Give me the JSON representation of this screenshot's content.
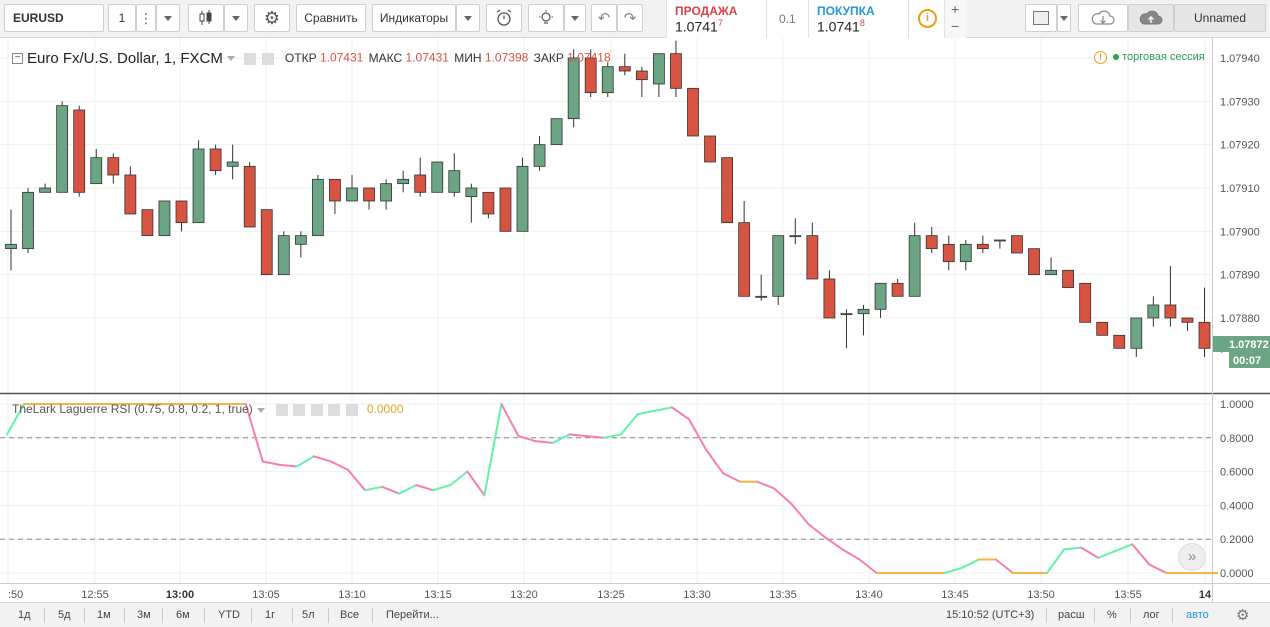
{
  "toolbar": {
    "symbol": "EURUSD",
    "interval": "1",
    "compare": "Сравнить",
    "indicators": "Индикаторы",
    "sell_label": "ПРОДАЖА",
    "sell_price_main": "1.0741",
    "sell_price_sup": "7",
    "spread": "0.1",
    "buy_label": "ПОКУПКА",
    "buy_price_main": "1.0741",
    "buy_price_sup": "8",
    "plus": "+",
    "minus": "−",
    "layout_name": "Unnamed",
    "info": "i"
  },
  "legend": {
    "title": "Euro Fx/U.S. Dollar, 1, FXCM",
    "open_label": "ОТКР",
    "open_value": "1.07431",
    "high_label": "МАКС",
    "high_value": "1.07431",
    "low_label": "МИН",
    "low_value": "1.07398",
    "close_label": "ЗАКР",
    "close_value": "1.07418",
    "session_text": "торговая сессия",
    "indicator_title": "TheLark Laguerre RSI (0.75, 0.8, 0.2, 1, true)",
    "indicator_value": "0.0000"
  },
  "price_axis": {
    "current_price": "1.07872",
    "countdown": "00:07"
  },
  "bottombar": {
    "ranges": [
      "1д",
      "5д",
      "1м",
      "3м",
      "6м",
      "YTD",
      "1г",
      "5л",
      "Все"
    ],
    "goto": "Перейти...",
    "clock": "15:10:52 (UTC+3)",
    "pct_scale": "расш",
    "pct": "%",
    "log": "лог",
    "auto": "авто"
  },
  "colors": {
    "up": "#6ba583",
    "down": "#d75442",
    "red_text": "#e0404a",
    "blue_text": "#1f9ad6",
    "session_green": "#2c9e55",
    "info_orange": "#f39c12",
    "rsi_up": "#62f2a8",
    "rsi_down": "#f77fa9",
    "rsi_flat": "#f5b53f"
  },
  "chart_data": [
    {
      "type": "candlestick",
      "title": "Euro Fx/U.S. Dollar, 1, FXCM",
      "y_ticks": [
        1.0794,
        1.0793,
        1.0792,
        1.0791,
        1.079,
        1.0789,
        1.0788
      ],
      "y_tick_labels": [
        "1.07940",
        "1.07930",
        "1.07920",
        "1.07910",
        "1.07900",
        "1.07890",
        "1.07880"
      ],
      "ylim": [
        1.0786,
        1.0795
      ],
      "x_tick_labels": [
        ":50",
        "12:55",
        "13:00",
        "13:05",
        "13:10",
        "13:15",
        "13:20",
        "13:25",
        "13:30",
        "13:35",
        "13:40",
        "13:45",
        "13:50",
        "13:55",
        "14"
      ],
      "candles": [
        [
          1.07896,
          1.07896,
          1.07897,
          1.07905,
          1.07891
        ],
        [
          1.07898,
          1.07896,
          1.07909,
          1.0791,
          1.07895
        ],
        [
          1.07909,
          1.07909,
          1.0791,
          1.07911,
          1.07909
        ],
        [
          1.07909,
          1.07909,
          1.07929,
          1.0793,
          1.07909
        ],
        [
          1.07928,
          1.07928,
          1.07909,
          1.07929,
          1.07908
        ],
        [
          1.07911,
          1.07911,
          1.07917,
          1.07919,
          1.07911
        ],
        [
          1.07917,
          1.07917,
          1.07913,
          1.07918,
          1.07911
        ],
        [
          1.07913,
          1.07913,
          1.07904,
          1.07915,
          1.07904
        ],
        [
          1.07905,
          1.07905,
          1.07899,
          1.07905,
          1.07899
        ],
        [
          1.07899,
          1.07899,
          1.07907,
          1.07907,
          1.07899
        ],
        [
          1.07907,
          1.07907,
          1.07902,
          1.07907,
          1.079
        ],
        [
          1.07902,
          1.07902,
          1.07919,
          1.07921,
          1.07902
        ],
        [
          1.07919,
          1.07919,
          1.07914,
          1.0792,
          1.07913
        ],
        [
          1.07915,
          1.07915,
          1.07916,
          1.0792,
          1.07912
        ],
        [
          1.07915,
          1.07915,
          1.07901,
          1.07916,
          1.07901
        ],
        [
          1.07905,
          1.07905,
          1.0789,
          1.07905,
          1.0789
        ],
        [
          1.0789,
          1.0789,
          1.07899,
          1.079,
          1.0789
        ],
        [
          1.07897,
          1.07897,
          1.07899,
          1.079,
          1.07894
        ],
        [
          1.07899,
          1.07899,
          1.07912,
          1.07913,
          1.07899
        ],
        [
          1.07912,
          1.07912,
          1.07907,
          1.07912,
          1.07904
        ],
        [
          1.07907,
          1.07907,
          1.0791,
          1.07913,
          1.07907
        ],
        [
          1.0791,
          1.0791,
          1.07907,
          1.0791,
          1.07905
        ],
        [
          1.07907,
          1.07907,
          1.07911,
          1.07912,
          1.07905
        ],
        [
          1.07911,
          1.07911,
          1.07912,
          1.07914,
          1.07909
        ],
        [
          1.07913,
          1.07913,
          1.07909,
          1.07917,
          1.07908
        ],
        [
          1.07909,
          1.07909,
          1.07916,
          1.07916,
          1.07909
        ],
        [
          1.07909,
          1.07909,
          1.07914,
          1.07918,
          1.07908
        ],
        [
          1.07908,
          1.07908,
          1.0791,
          1.07911,
          1.07902
        ],
        [
          1.07909,
          1.07909,
          1.07904,
          1.07909,
          1.07903
        ],
        [
          1.0791,
          1.0791,
          1.079,
          1.0791,
          1.079
        ],
        [
          1.079,
          1.079,
          1.07915,
          1.07917,
          1.079
        ],
        [
          1.07915,
          1.07915,
          1.0792,
          1.07922,
          1.07914
        ],
        [
          1.0792,
          1.0792,
          1.07926,
          1.07926,
          1.0792
        ],
        [
          1.07926,
          1.07926,
          1.0794,
          1.07942,
          1.07924
        ],
        [
          1.0794,
          1.0794,
          1.07932,
          1.07942,
          1.07931
        ],
        [
          1.07932,
          1.07932,
          1.07938,
          1.07939,
          1.07931
        ],
        [
          1.07938,
          1.07938,
          1.07937,
          1.07941,
          1.07936
        ],
        [
          1.07937,
          1.07937,
          1.07935,
          1.07938,
          1.07931
        ],
        [
          1.07934,
          1.07934,
          1.07941,
          1.07941,
          1.07931
        ],
        [
          1.07941,
          1.07941,
          1.07933,
          1.07944,
          1.07931
        ],
        [
          1.07933,
          1.07933,
          1.07922,
          1.07933,
          1.07922
        ],
        [
          1.07922,
          1.07922,
          1.07916,
          1.07922,
          1.07916
        ],
        [
          1.07917,
          1.07917,
          1.07902,
          1.07917,
          1.07902
        ],
        [
          1.07902,
          1.07902,
          1.07885,
          1.07907,
          1.07885
        ],
        [
          1.07885,
          1.07885,
          1.07885,
          1.0789,
          1.07884
        ],
        [
          1.07885,
          1.07885,
          1.07899,
          1.07899,
          1.07883
        ],
        [
          1.07899,
          1.07899,
          1.07899,
          1.07903,
          1.07897
        ],
        [
          1.07899,
          1.07899,
          1.07889,
          1.07902,
          1.07889
        ],
        [
          1.07889,
          1.07889,
          1.0788,
          1.07891,
          1.0788
        ],
        [
          1.07881,
          1.07881,
          1.07881,
          1.07882,
          1.07873
        ],
        [
          1.07881,
          1.07881,
          1.07882,
          1.07883,
          1.07876
        ],
        [
          1.07882,
          1.07882,
          1.07888,
          1.07888,
          1.0788
        ],
        [
          1.07888,
          1.07888,
          1.07885,
          1.07889,
          1.07885
        ],
        [
          1.07885,
          1.07885,
          1.07899,
          1.07902,
          1.07885
        ],
        [
          1.07899,
          1.07899,
          1.07896,
          1.07901,
          1.07895
        ],
        [
          1.07897,
          1.07897,
          1.07893,
          1.07899,
          1.07891
        ],
        [
          1.07893,
          1.07893,
          1.07897,
          1.07898,
          1.07891
        ],
        [
          1.07897,
          1.07897,
          1.07896,
          1.07899,
          1.07895
        ],
        [
          1.07898,
          1.07898,
          1.07898,
          1.07898,
          1.07896
        ],
        [
          1.07899,
          1.07899,
          1.07895,
          1.07899,
          1.07895
        ],
        [
          1.07896,
          1.07896,
          1.0789,
          1.07896,
          1.0789
        ],
        [
          1.0789,
          1.0789,
          1.07891,
          1.07894,
          1.0789
        ],
        [
          1.07891,
          1.07891,
          1.07887,
          1.07891,
          1.07887
        ],
        [
          1.07888,
          1.07888,
          1.07879,
          1.07888,
          1.07879
        ],
        [
          1.07879,
          1.07879,
          1.07876,
          1.07879,
          1.07876
        ],
        [
          1.07876,
          1.07876,
          1.07873,
          1.07876,
          1.07873
        ],
        [
          1.07873,
          1.07873,
          1.0788,
          1.0788,
          1.07871
        ],
        [
          1.0788,
          1.0788,
          1.07883,
          1.07885,
          1.07878
        ],
        [
          1.07883,
          1.07883,
          1.0788,
          1.07892,
          1.07878
        ],
        [
          1.0788,
          1.0788,
          1.07879,
          1.0788,
          1.07877
        ],
        [
          1.07879,
          1.07879,
          1.07873,
          1.07887,
          1.07871
        ],
        [
          1.07873,
          1.07873,
          1.07874,
          1.07874,
          1.07872
        ]
      ],
      "candle_columns": [
        "open",
        "open_",
        "close",
        "high",
        "low"
      ]
    },
    {
      "type": "line",
      "title": "TheLark Laguerre RSI (0.75, 0.8, 0.2, 1, true)",
      "y_ticks": [
        1.0,
        0.8,
        0.6,
        0.4,
        0.2,
        0.0
      ],
      "y_tick_labels": [
        "1.0000",
        "0.8000",
        "0.6000",
        "0.4000",
        "0.2000",
        "0.0000"
      ],
      "levels": [
        0.8,
        0.2
      ],
      "ylim": [
        -0.03,
        1.04
      ],
      "values": [
        0.82,
        1.0,
        1.0,
        1.0,
        1.0,
        1.0,
        1.0,
        1.0,
        1.0,
        1.0,
        1.0,
        1.0,
        1.0,
        1.0,
        1.0,
        0.66,
        0.64,
        0.63,
        0.69,
        0.66,
        0.61,
        0.49,
        0.51,
        0.47,
        0.52,
        0.49,
        0.52,
        0.6,
        0.46,
        1.0,
        0.81,
        0.78,
        0.77,
        0.82,
        0.81,
        0.8,
        0.82,
        0.94,
        0.96,
        0.98,
        0.91,
        0.73,
        0.59,
        0.54,
        0.54,
        0.5,
        0.41,
        0.29,
        0.21,
        0.14,
        0.08,
        0.0,
        0.0,
        0.0,
        0.0,
        0.0,
        0.03,
        0.08,
        0.08,
        0.0,
        0.0,
        0.0,
        0.14,
        0.15,
        0.09,
        0.13,
        0.17,
        0.05,
        0.0,
        0.0,
        0.0,
        0.0
      ]
    }
  ]
}
